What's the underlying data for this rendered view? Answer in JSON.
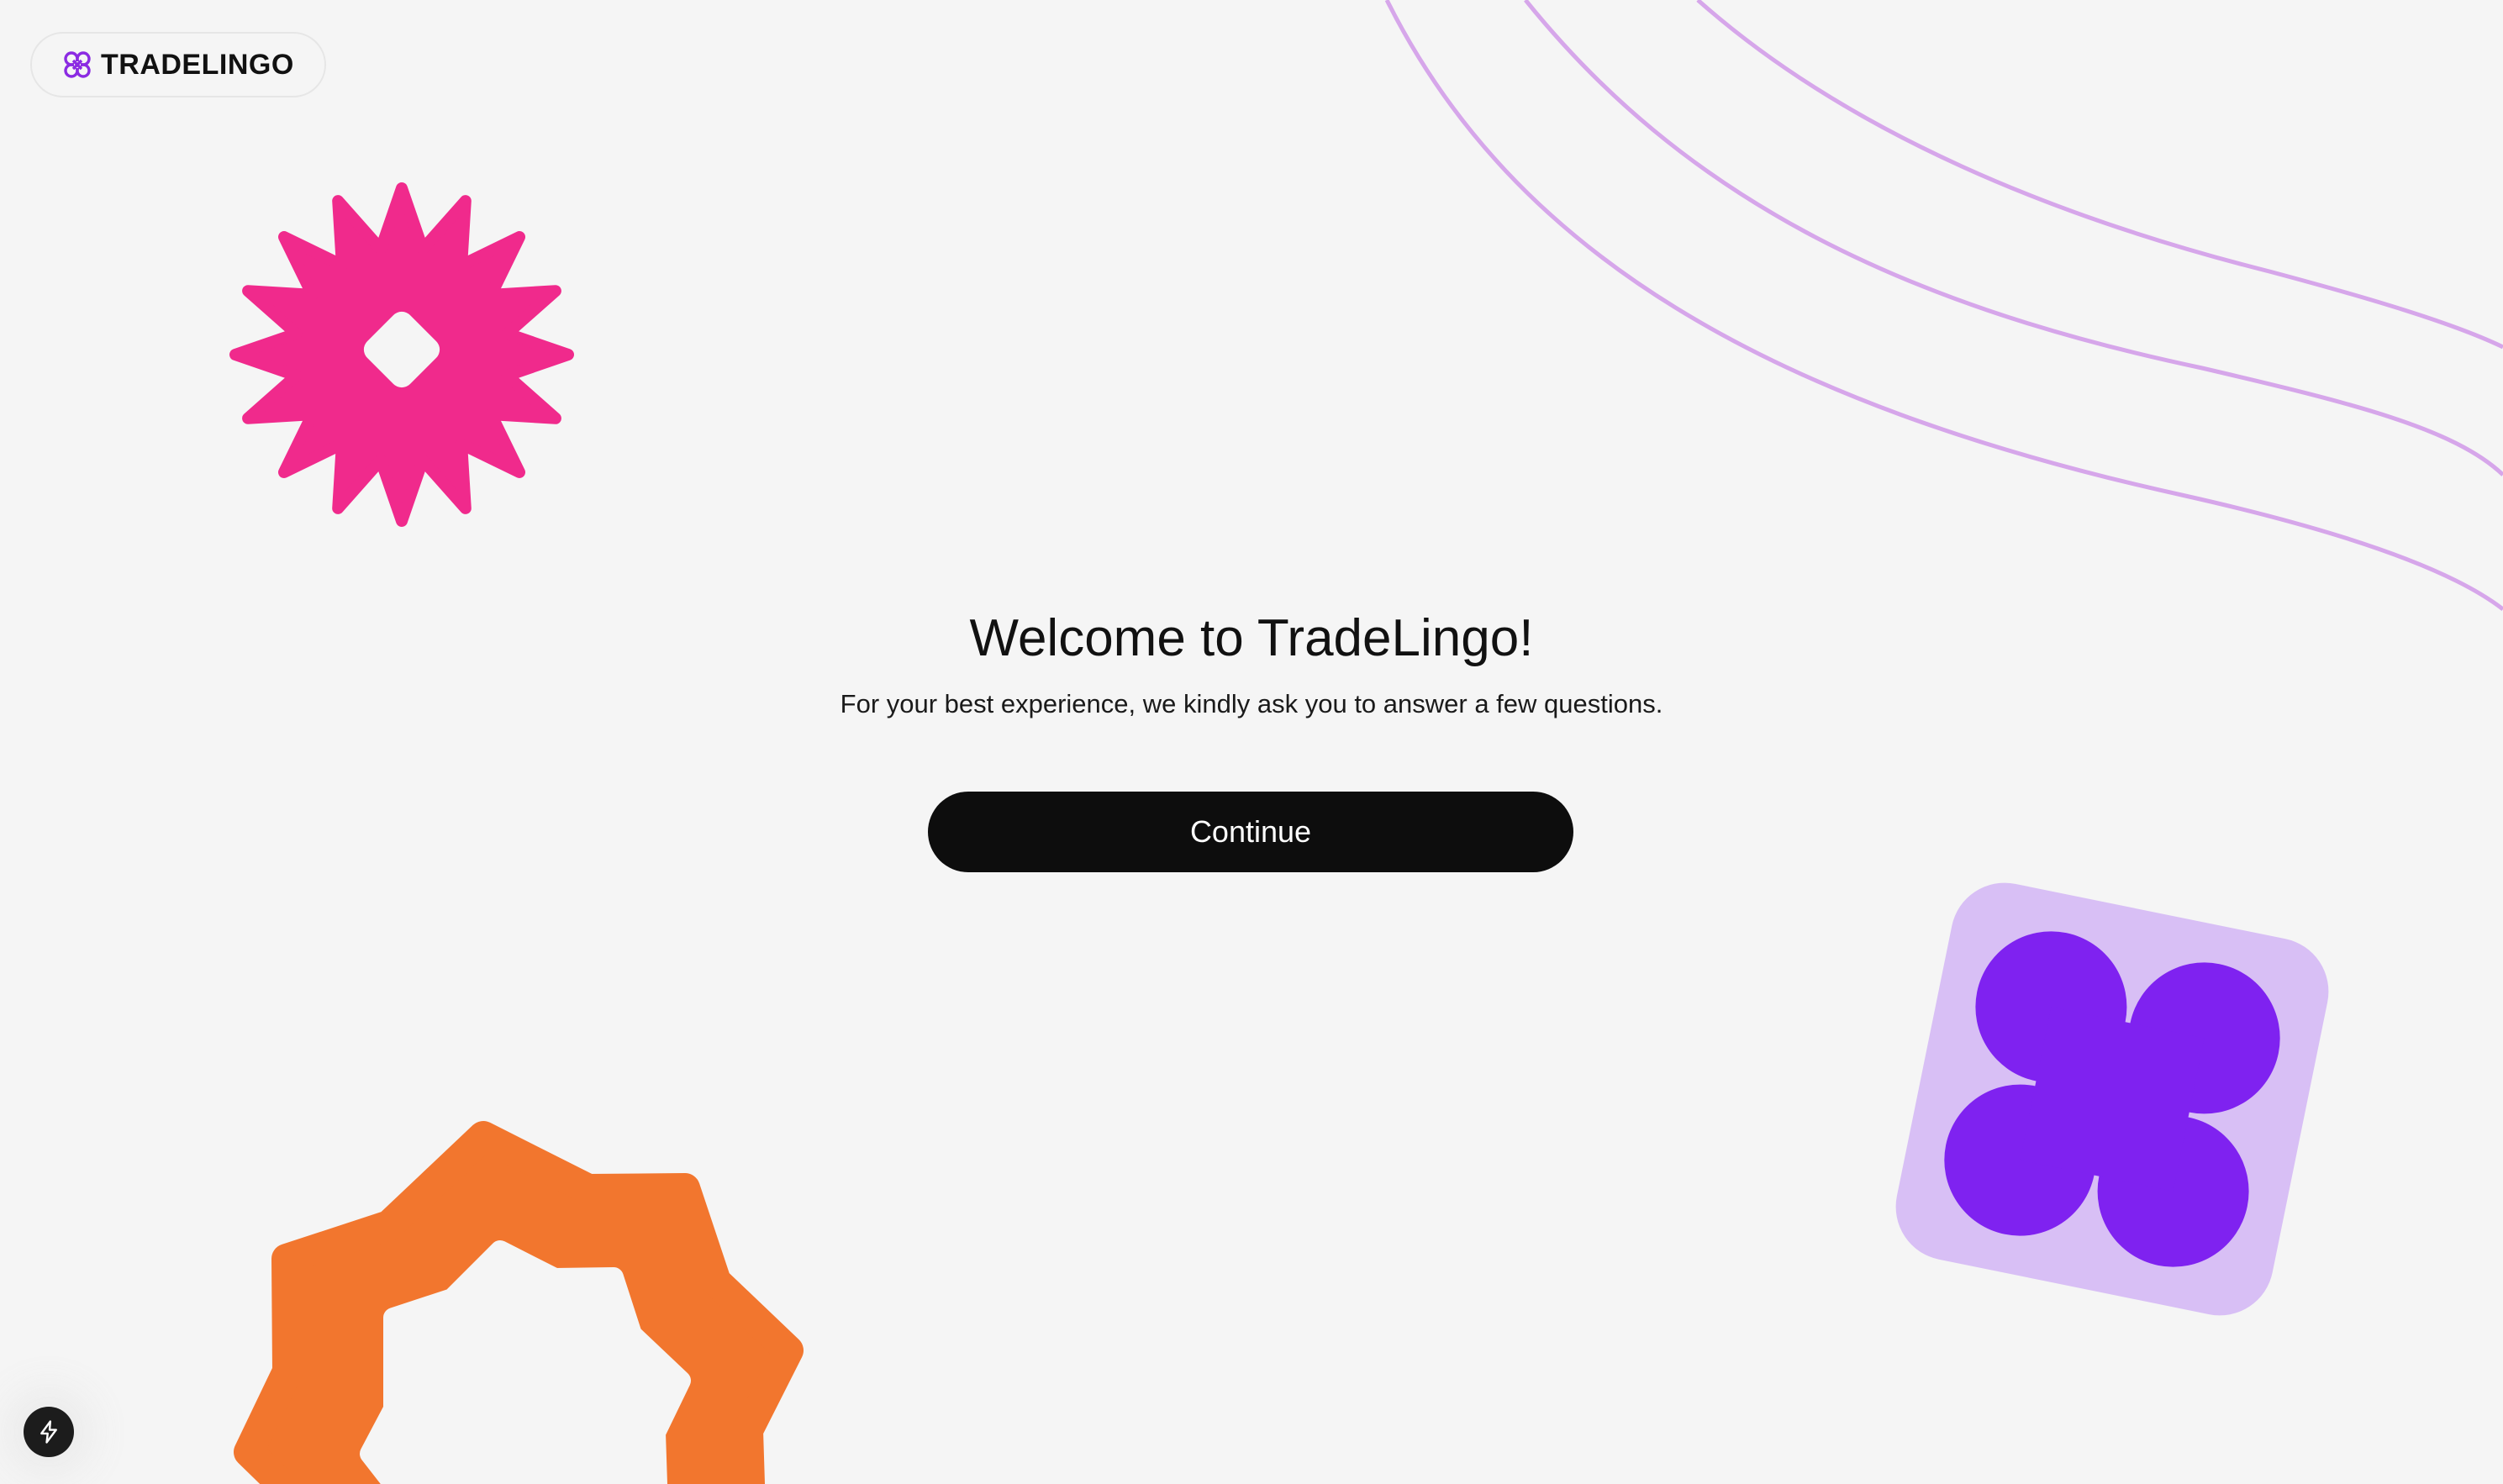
{
  "app": {
    "brand_name": "TRADELINGO",
    "logo_icon": "atom-knot-icon"
  },
  "welcome": {
    "title": "Welcome to TradeLingo!",
    "subtitle": "For your best experience, we kindly ask you to answer a few questions.",
    "continue_label": "Continue"
  },
  "dev_tools": {
    "icon": "lightning-bolt-icon"
  },
  "colors": {
    "background": "#f5f5f5",
    "brand_purple": "#8b2be2",
    "star_pink": "#f02a8c",
    "curve_lavender": "#d6a6ea",
    "ring_orange": "#f2762e",
    "tile_lavender": "#d8bff5",
    "clover_purple": "#7f22f0",
    "button_black": "#0d0d0d"
  }
}
